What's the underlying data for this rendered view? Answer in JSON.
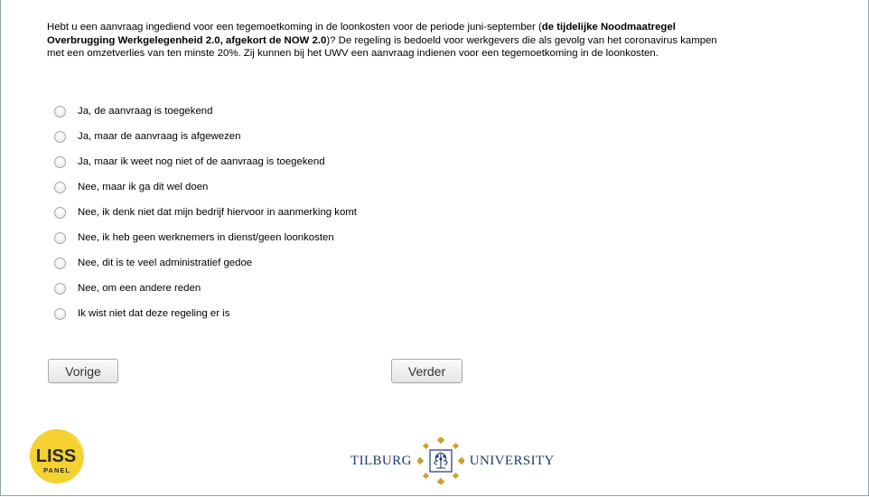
{
  "question": {
    "text_before": "Hebt u een aanvraag ingediend voor een tegemoetkoming in de loonkosten voor de periode juni-september (",
    "text_bold": "de tijdelijke Noodmaatregel Overbrugging Werkgelegenheid 2.0, afgekort de NOW 2.0",
    "text_after": ")? De regeling is bedoeld voor werkgevers die als gevolg van het coronavirus kampen met een omzetverlies van ten minste 20%. Zij kunnen bij het UWV een aanvraag indienen voor een tegemoetkoming in de loonkosten."
  },
  "options": [
    {
      "label": "Ja, de aanvraag is toegekend"
    },
    {
      "label": "Ja, maar de aanvraag is afgewezen"
    },
    {
      "label": "Ja, maar ik weet nog niet of de aanvraag is toegekend"
    },
    {
      "label": "Nee, maar ik ga dit wel doen"
    },
    {
      "label": "Nee, ik denk niet dat mijn bedrijf hiervoor in aanmerking komt"
    },
    {
      "label": "Nee, ik heb geen werknemers in dienst/geen loonkosten"
    },
    {
      "label": "Nee, dit is te veel administratief gedoe"
    },
    {
      "label": "Nee, om een andere reden"
    },
    {
      "label": "Ik wist niet dat deze regeling er is"
    }
  ],
  "buttons": {
    "prev_label": "Vorige",
    "next_label": "Verder"
  },
  "footer": {
    "liss_logo_line1": "LISS",
    "liss_logo_line2": "PANEL",
    "tilburg_left": "TILBURG",
    "tilburg_right": "UNIVERSITY"
  },
  "colors": {
    "liss_yellow": "#f5d231",
    "tilburg_blue": "#1d3a6e",
    "tilburg_gold": "#c9a227"
  }
}
